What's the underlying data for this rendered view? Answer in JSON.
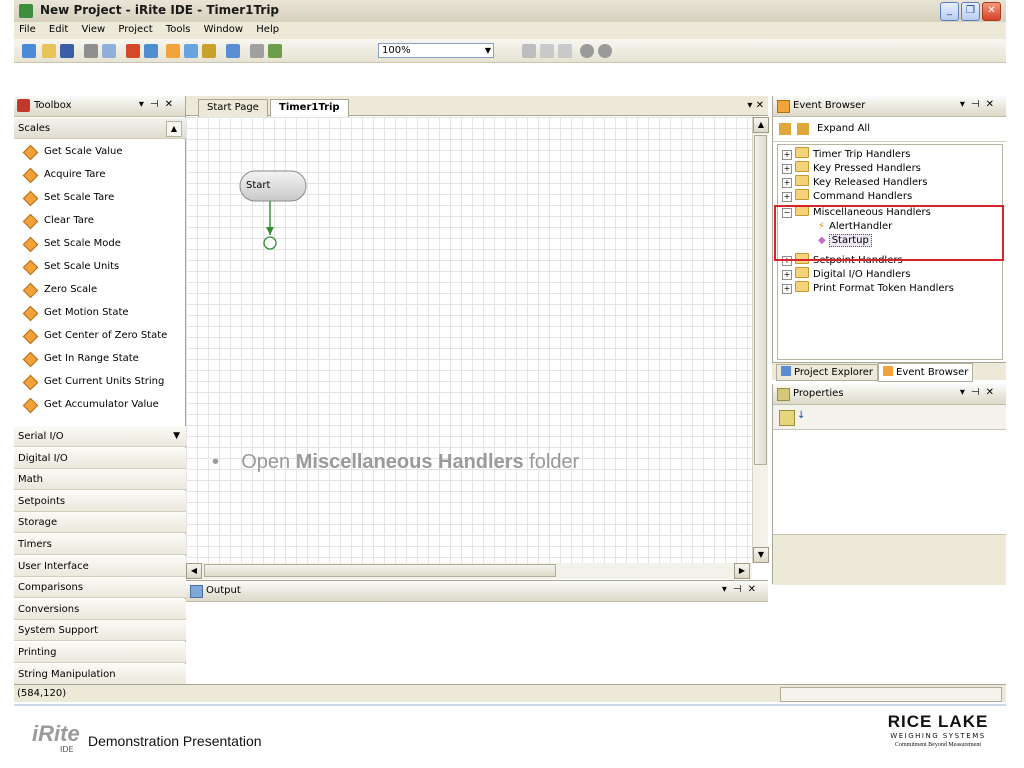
{
  "window": {
    "title": "New Project - iRite IDE - Timer1Trip"
  },
  "menu": [
    "File",
    "Edit",
    "View",
    "Project",
    "Tools",
    "Window",
    "Help"
  ],
  "toolbar": {
    "zoom": "100%"
  },
  "toolbox": {
    "title": "Toolbox",
    "open_category": "Scales",
    "tools": [
      "Get Scale Value",
      "Acquire Tare",
      "Set Scale Tare",
      "Clear Tare",
      "Set Scale Mode",
      "Set Scale Units",
      "Zero Scale",
      "Get Motion State",
      "Get Center of Zero State",
      "Get In Range State",
      "Get Current Units String",
      "Get Accumulator Value"
    ],
    "categories": [
      "Serial I/O",
      "Digital I/O",
      "Math",
      "Setpoints",
      "Storage",
      "Timers",
      "User Interface",
      "Comparisons",
      "Conversions",
      "System Support",
      "Printing",
      "String Manipulation"
    ]
  },
  "document": {
    "tabs": [
      "Start Page",
      "Timer1Trip"
    ],
    "start_node": "Start",
    "bullet": "•",
    "instruction_prefix": "Open ",
    "instruction_bold": "Miscellaneous Handlers",
    "instruction_suffix": " folder"
  },
  "output": {
    "title": "Output"
  },
  "event_browser": {
    "title": "Event Browser",
    "expand_all": "Expand All",
    "items": [
      "Timer Trip Handlers",
      "Key Pressed Handlers",
      "Key Released Handlers",
      "Command Handlers",
      "Miscellaneous Handlers",
      "AlertHandler",
      "Startup",
      "Setpoint Handlers",
      "Digital I/O Handlers",
      "Print Format Token Handlers"
    ]
  },
  "bottom_tabs": [
    "Project Explorer",
    "Event Browser"
  ],
  "properties": {
    "title": "Properties"
  },
  "status": {
    "coords": "(584,120)"
  },
  "footer": {
    "logo": "iRite",
    "logo_sub": "IDE",
    "caption": "Demonstration Presentation",
    "brand_main": "RICE LAKE",
    "brand_sub": "WEIGHING SYSTEMS",
    "brand_tagline": "Commitment Beyond Measurement"
  }
}
